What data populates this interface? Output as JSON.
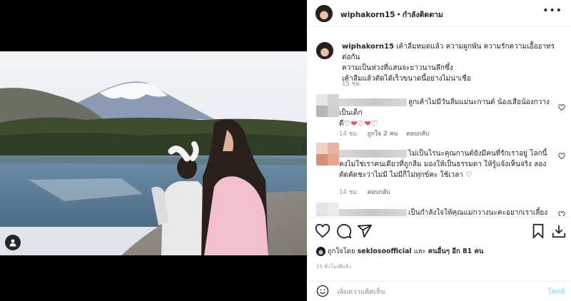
{
  "post": {
    "username": "wiphakorn15",
    "follow_status": "กำลังติดตาม",
    "more_label": "•••",
    "caption": {
      "username": "wiphakorn15",
      "lines": [
        " เค้าลืมหมดแล้ว ความผูกพัน ความรักความเอื้ออาทรต่อกัน",
        "ความเป็นห่วงที่แสนจะยาวนานลึกซึ้ง",
        "เค้าลืมแล้วตัดได้เร็วขนาดนี้อย่างไม่น่าเชื่อ"
      ],
      "time": "15 ชม."
    }
  },
  "comments": [
    {
      "lines": [
        "ลูกเค้าไม่มีวันลืมแม่นะกานต์ น้องเสือน้องกวางเป็นเด็ก",
        "ดี"
      ],
      "hearts": [
        "♡",
        "❤",
        "♡",
        "❤",
        "♡"
      ],
      "time": "14 ชม.",
      "likes": "ถูกใจ 2 คน",
      "reply": "ตอบกลับ"
    },
    {
      "lines": [
        "ไม่เป็นไรนะคุณกานต์ยังมีคนที่รักเราอยู่ โลกนี้",
        "คงไม่ใช่เราคนเดียวที่ถูกลืม มองให้เป็นธรรมดา ให้รู้แจ้งเห็นจริง ลอง",
        "ตัดคัดชะว่าไม่มี ไม่มีก็ไม่ทุกข์คะ ใช้เวลา ♡"
      ],
      "time": "14 ชม.",
      "reply": "ตอบกลับ"
    },
    {
      "lines": [
        "เป็นกำลังใจให้คุณแม่กวางนะคะอยากเราเลี้ยงเค้าได้แต่ตัว"
      ]
    }
  ],
  "actions": {
    "liked_by_prefix": "ถูกใจโดย ",
    "liked_by_user": "seklosoofficial",
    "liked_by_and": " และ ",
    "liked_by_others": "คนอื่นๆ อีก 81 คน",
    "posted_time": "15 ชั่วโมงที่แล้ว"
  },
  "add_comment": {
    "placeholder": "เพิ่มความคิดเห็น",
    "post_label": "โพสต์"
  },
  "colors": {
    "link_disabled": "#b2dffc",
    "heart_red": "#ed4956",
    "muted": "#8e8e8e"
  },
  "icons": [
    "like-icon",
    "comment-icon",
    "share-icon",
    "save-icon",
    "download-icon",
    "emoji-icon",
    "user-tag-icon",
    "more-icon"
  ]
}
